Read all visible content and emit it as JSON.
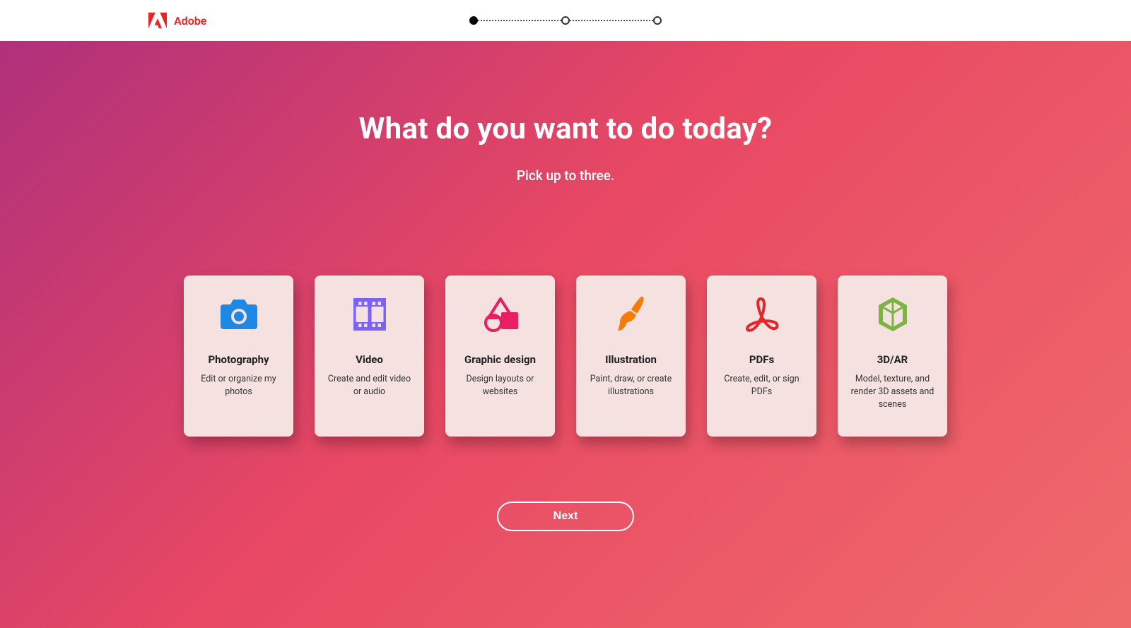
{
  "brand": {
    "name": "Adobe",
    "logo_color": "#ED2224"
  },
  "stepper": {
    "total_steps": 3,
    "current_step": 1
  },
  "hero": {
    "heading": "What do you want to do today?",
    "subheading": "Pick up to three.",
    "next_label": "Next"
  },
  "cards": [
    {
      "id": "photography",
      "title": "Photography",
      "desc": "Edit or organize my photos",
      "icon": "camera-icon",
      "icon_color": "#1E88E5"
    },
    {
      "id": "video",
      "title": "Video",
      "desc": "Create and edit video or audio",
      "icon": "film-icon",
      "icon_color": "#7B61FF"
    },
    {
      "id": "graphic-design",
      "title": "Graphic design",
      "desc": "Design layouts or websites",
      "icon": "shapes-icon",
      "icon_color": "#E91E63"
    },
    {
      "id": "illustration",
      "title": "Illustration",
      "desc": "Paint, draw, or create illustrations",
      "icon": "brush-icon",
      "icon_color": "#F57C00"
    },
    {
      "id": "pdfs",
      "title": "PDFs",
      "desc": "Create, edit, or sign PDFs",
      "icon": "acrobat-icon",
      "icon_color": "#E6252A"
    },
    {
      "id": "3d-ar",
      "title": "3D/AR",
      "desc": "Model, texture, and render 3D assets and scenes",
      "icon": "cube-icon",
      "icon_color": "#7CB342"
    }
  ]
}
